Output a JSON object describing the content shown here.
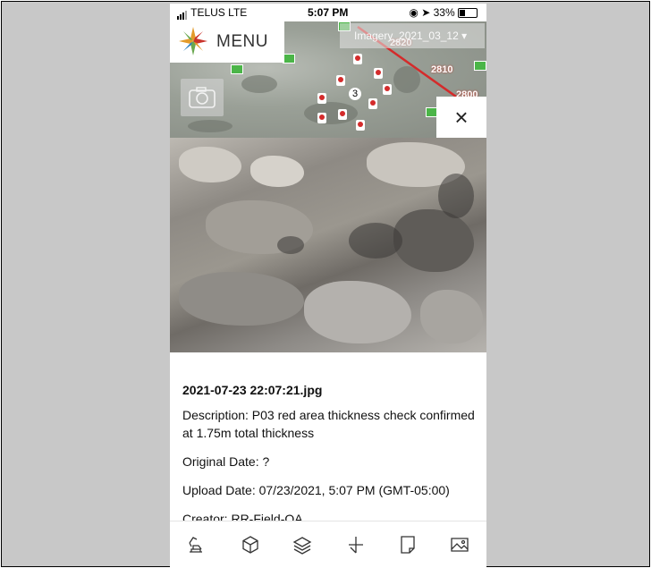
{
  "status_bar": {
    "carrier": "TELUS",
    "network": "LTE",
    "time": "5:07 PM",
    "battery": "33%"
  },
  "map": {
    "menu_label": "MENU",
    "imagery_label": "Imagery_2021_03_12",
    "route_labels": [
      "2820",
      "2810",
      "2800"
    ],
    "cluster_count": "3",
    "close_symbol": "×"
  },
  "photo_info": {
    "file_name": "2021-07-23 22:07:21.jpg",
    "description": "Description: P03 red area thickness check confirmed at 1.75m total thickness",
    "original_date": "Original Date: ?",
    "upload_date": "Upload Date: 07/23/2021, 5:07 PM (GMT-05:00)",
    "creator": "Creator: RR-Field-QA"
  },
  "toolbar": {
    "icons": [
      "excavator-icon",
      "cube-icon",
      "layers-icon",
      "measure-icon",
      "note-icon",
      "image-icon"
    ]
  },
  "colors": {
    "route_red": "#d42b2b",
    "flag_green": "#4bb548"
  }
}
